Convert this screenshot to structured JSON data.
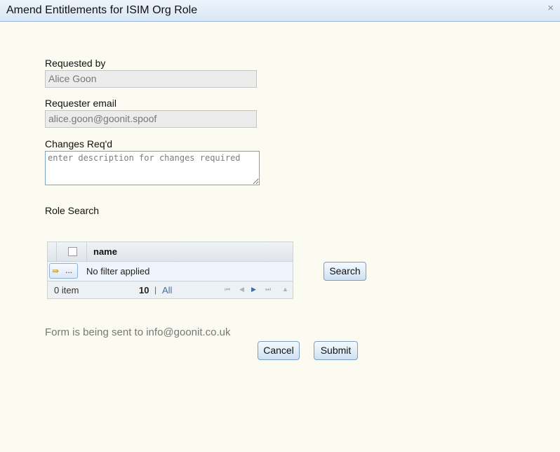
{
  "window": {
    "title": "Amend Entitlements for ISIM Org Role",
    "close_glyph": "×"
  },
  "form": {
    "requested_by": {
      "label": "Requested by",
      "value": "Alice Goon"
    },
    "requester_email": {
      "label": "Requester email",
      "value": "alice.goon@goonit.spoof"
    },
    "changes": {
      "label": "Changes Req'd",
      "placeholder": "enter description for changes required"
    },
    "role_search_label": "Role Search"
  },
  "grid": {
    "column_name": "name",
    "filter_button_icon": "filter-arrow-icon",
    "filter_button_dots": "...",
    "filter_text": "No filter applied",
    "item_count": "0 item",
    "page_size": "10",
    "separator": "|",
    "page_all": "All",
    "pager_icons": {
      "first": "⏮",
      "prev": "◀",
      "next": "▶",
      "last": "⏭",
      "goto": "▲"
    }
  },
  "buttons": {
    "search": "Search",
    "cancel": "Cancel",
    "submit": "Submit"
  },
  "footer": {
    "info": "Form is being sent to info@goonit.co.uk"
  },
  "colors": {
    "background": "#fbfbf1",
    "titlebar": "#dce8f5",
    "accent": "#3b6ea8"
  }
}
